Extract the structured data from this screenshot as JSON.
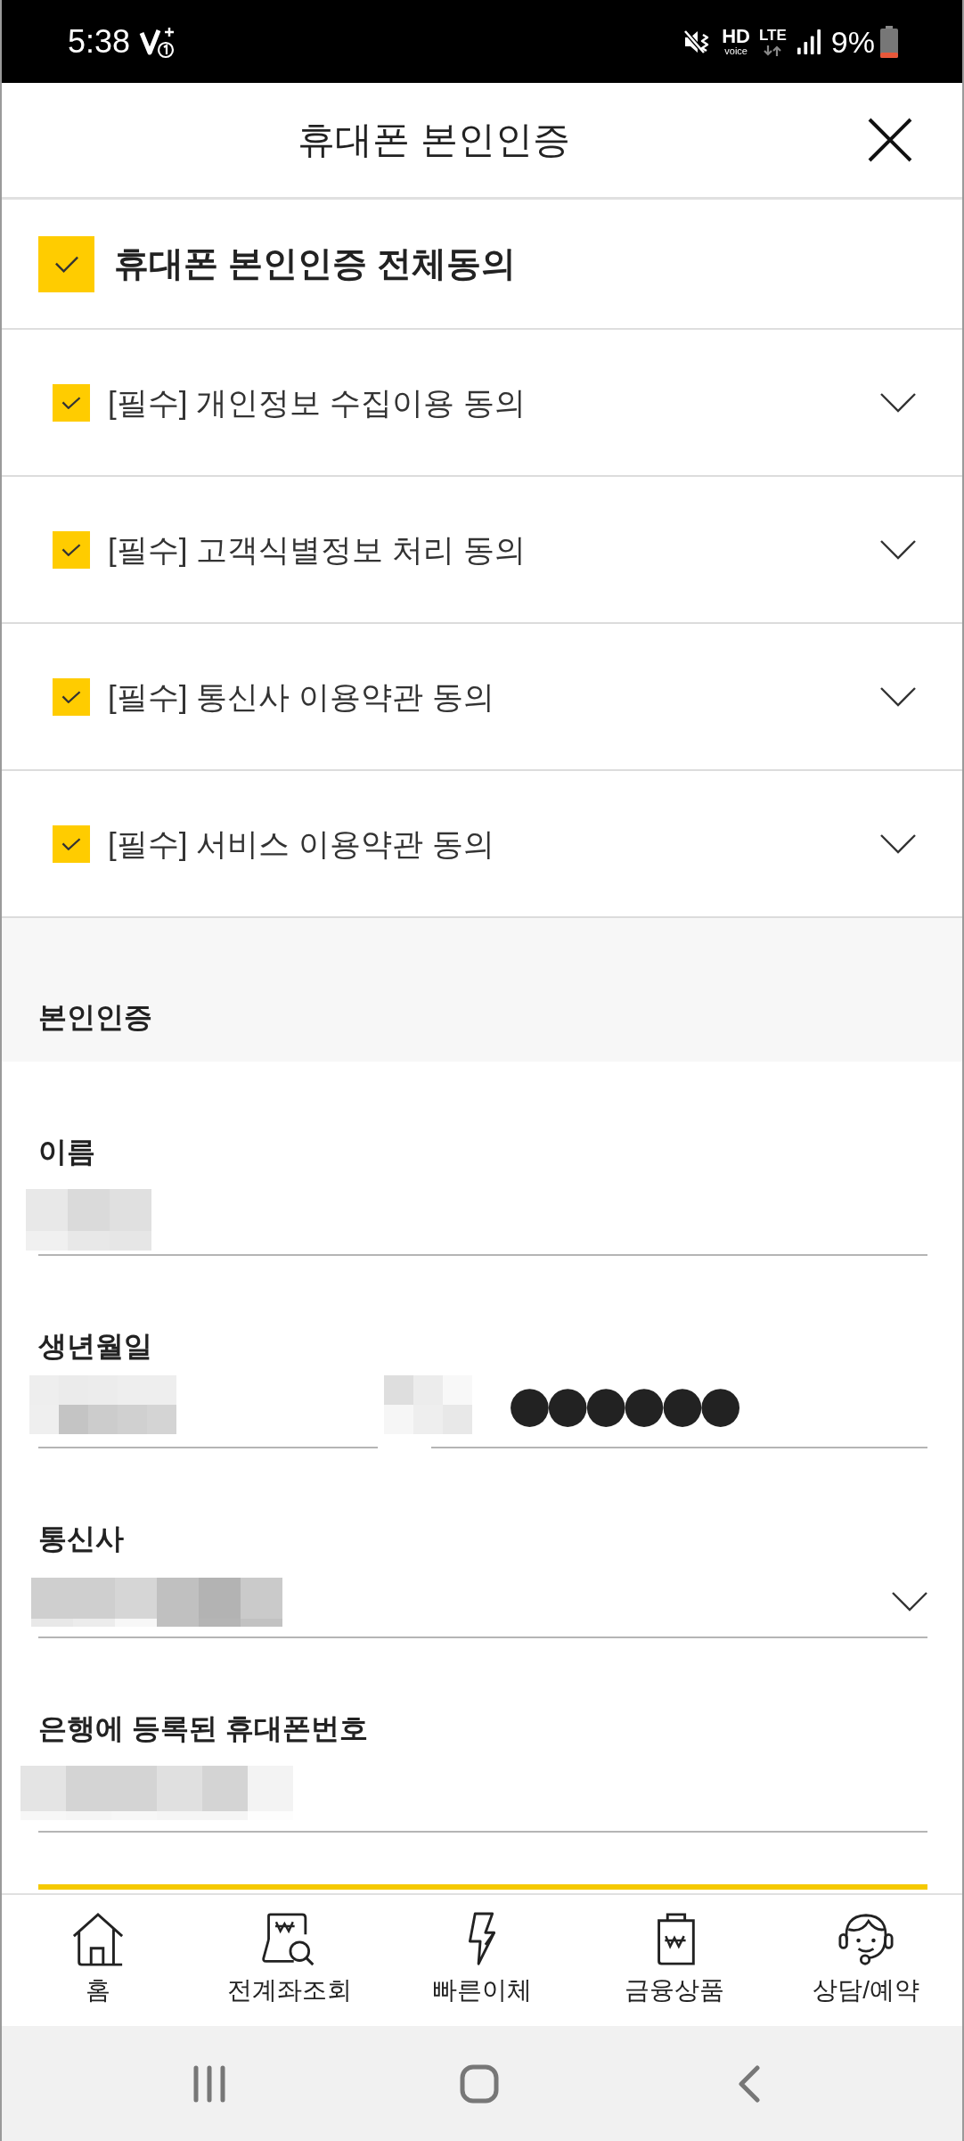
{
  "status_bar": {
    "time": "5:38",
    "hd": "HD",
    "voice": "voice",
    "network": "LTE",
    "battery": "9%"
  },
  "header": {
    "title": "휴대폰 본인인증"
  },
  "agree_all": {
    "label": "휴대폰 본인인증 전체동의",
    "checked": true
  },
  "agreements": [
    {
      "label": "[필수] 개인정보 수집이용 동의",
      "checked": true,
      "expanded": false
    },
    {
      "label": "[필수] 고객식별정보 처리 동의",
      "checked": true,
      "expanded": false
    },
    {
      "label": "[필수] 통신사 이용약관 동의",
      "checked": true,
      "expanded": false
    },
    {
      "label": "[필수] 서비스 이용약관 동의",
      "checked": true,
      "expanded": false
    }
  ],
  "verification": {
    "title": "본인인증",
    "fields": [
      {
        "kind": "text",
        "label": "이름",
        "pixelated": true
      },
      {
        "kind": "birthdate",
        "label": "생년월일",
        "pixelated": true,
        "masked": "●●●●●●"
      },
      {
        "kind": "select",
        "label": "통신사",
        "pixelated": true
      },
      {
        "kind": "text",
        "label": "은행에 등록된 휴대폰번호",
        "pixelated": true
      }
    ]
  },
  "bottom_nav": [
    {
      "label": "홈"
    },
    {
      "label": "전계좌조회"
    },
    {
      "label": "빠른이체"
    },
    {
      "label": "금융상품"
    },
    {
      "label": "상담/예약"
    }
  ]
}
